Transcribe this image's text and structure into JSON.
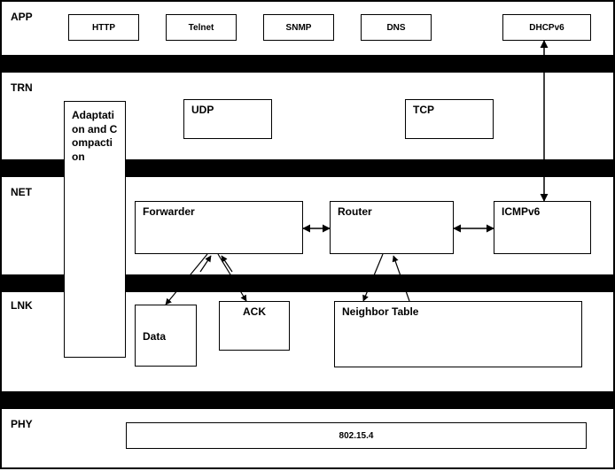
{
  "layers": {
    "app": "APP",
    "trn": "TRN",
    "net": "NET",
    "lnk": "LNK",
    "phy": "PHY"
  },
  "app_boxes": {
    "http": "HTTP",
    "telnet": "Telnet",
    "snmp": "SNMP",
    "dns": "DNS",
    "dhcpv6": "DHCPv6"
  },
  "trn_boxes": {
    "udp": "UDP",
    "tcp": "TCP"
  },
  "net_boxes": {
    "forwarder": "Forwarder",
    "router": "Router",
    "icmpv6": "ICMPv6"
  },
  "lnk_boxes": {
    "data": "Data",
    "ack": "ACK",
    "neighbor": "Neighbor Table"
  },
  "phy_boxes": {
    "phy": "802.15.4"
  },
  "span_box": {
    "adapt": "Adaptation and Compaction"
  }
}
